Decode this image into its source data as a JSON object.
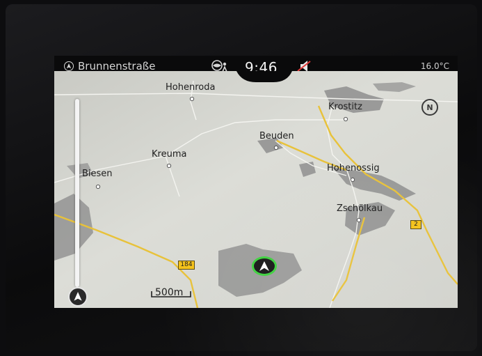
{
  "status_bar": {
    "street": "Brunnenstraße",
    "time": "9:46",
    "temperature": "16.0",
    "temperature_unit": "°C"
  },
  "map": {
    "towns": [
      {
        "name": "Hohenroda"
      },
      {
        "name": "Krostitz"
      },
      {
        "name": "Beuden"
      },
      {
        "name": "Kreuma"
      },
      {
        "name": "Hohenossig"
      },
      {
        "name": "Biesen"
      },
      {
        "name": "Zschölkau"
      }
    ],
    "road_shields": [
      {
        "label": "184"
      },
      {
        "label": "2"
      }
    ],
    "scale": "500m",
    "north_indicator": "N"
  },
  "colors": {
    "land": "#d9dad4",
    "settlement": "#8e8e8e",
    "main_road": "#e8c23a",
    "minor_road": "#f2f2ee",
    "position_ring": "#3fd13f"
  },
  "icons": {
    "street_compass": "compass-arrow-icon",
    "traffic": "traffic-globe-icon",
    "mute": "mute-speaker-icon",
    "north": "north-up-icon",
    "zoom_compass": "compass-arrow-icon",
    "vehicle": "vehicle-position-icon"
  }
}
